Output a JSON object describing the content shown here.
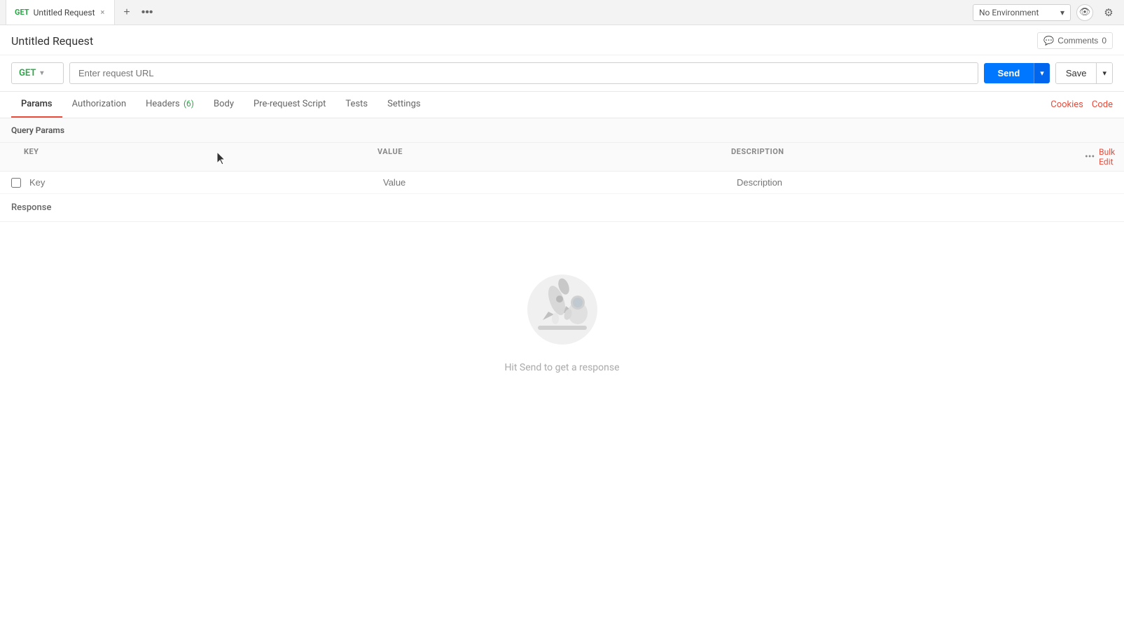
{
  "tab": {
    "method": "GET",
    "title": "Untitled Request",
    "close_label": "×"
  },
  "top_right": {
    "env_placeholder": "No Environment",
    "eye_icon": "👁",
    "gear_icon": "⚙",
    "chevron": "▾"
  },
  "request": {
    "title": "Untitled Request",
    "comments_label": "Comments",
    "comments_count": "0"
  },
  "url_bar": {
    "method": "GET",
    "url_placeholder": "Enter request URL",
    "send_label": "Send",
    "save_label": "Save"
  },
  "tabs": {
    "items": [
      {
        "label": "Params",
        "active": true,
        "badge": null
      },
      {
        "label": "Authorization",
        "active": false,
        "badge": null
      },
      {
        "label": "Headers",
        "active": false,
        "badge": "(6)"
      },
      {
        "label": "Body",
        "active": false,
        "badge": null
      },
      {
        "label": "Pre-request Script",
        "active": false,
        "badge": null
      },
      {
        "label": "Tests",
        "active": false,
        "badge": null
      },
      {
        "label": "Settings",
        "active": false,
        "badge": null
      }
    ],
    "right_links": [
      "Cookies",
      "Code"
    ]
  },
  "query_params": {
    "section_title": "Query Params",
    "columns": [
      "KEY",
      "VALUE",
      "DESCRIPTION"
    ],
    "bulk_edit_label": "Bulk Edit",
    "row": {
      "key_placeholder": "Key",
      "value_placeholder": "Value",
      "desc_placeholder": "Description"
    }
  },
  "response": {
    "section_title": "Response",
    "empty_message": "Hit Send to get a response"
  }
}
